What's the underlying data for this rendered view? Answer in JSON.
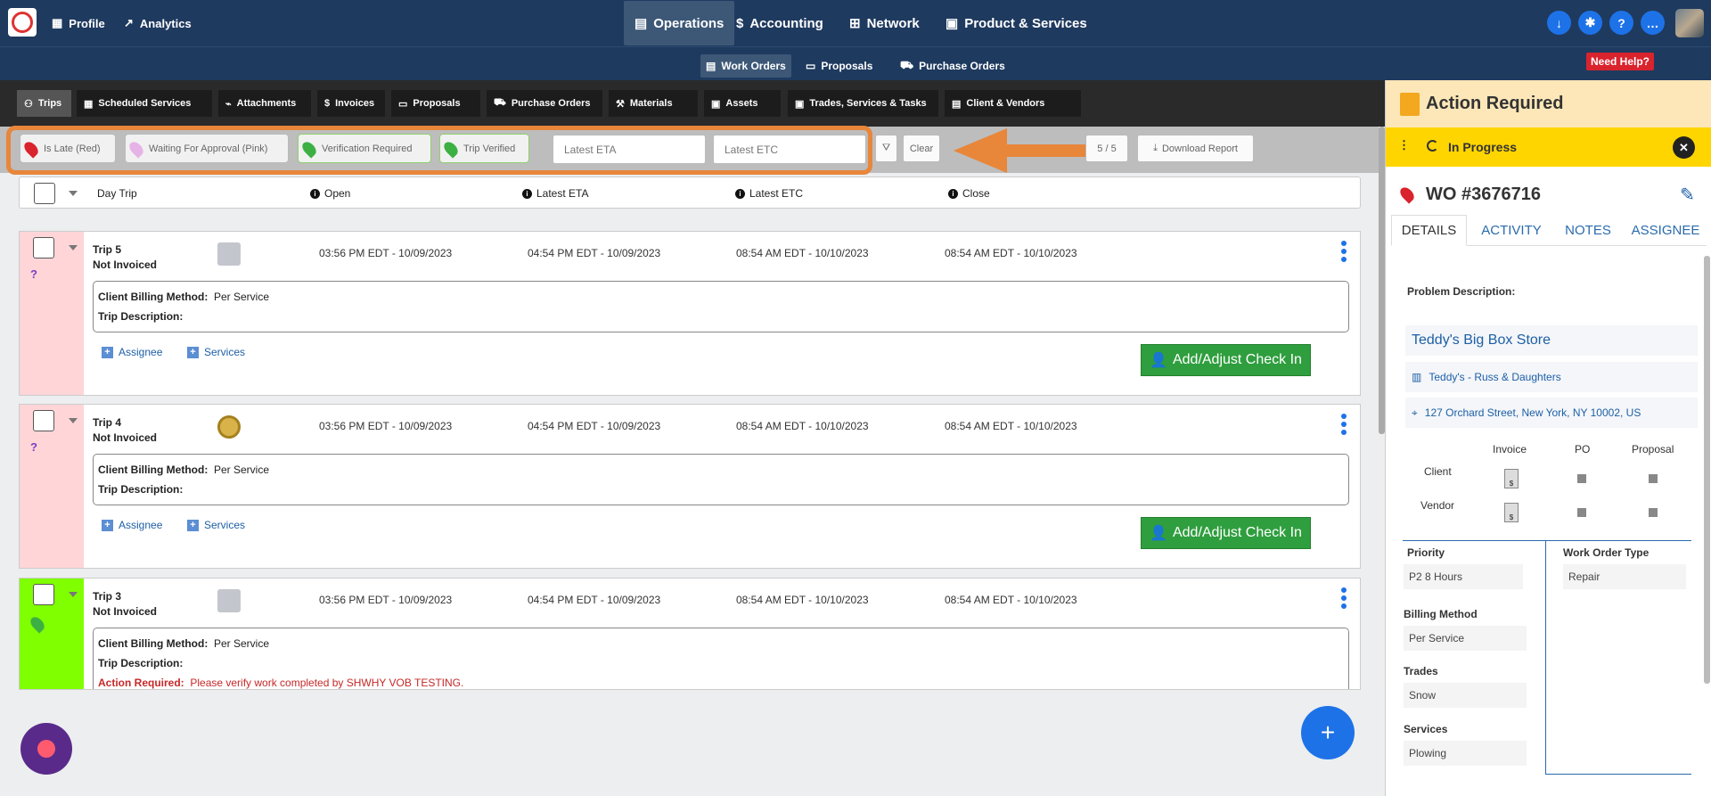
{
  "topnav": {
    "profile": "Profile",
    "analytics": "Analytics",
    "operations": "Operations",
    "accounting": "Accounting",
    "network": "Network",
    "product_services": "Product & Services"
  },
  "subnav": {
    "work_orders": "Work Orders",
    "proposals": "Proposals",
    "purchase_orders": "Purchase Orders",
    "need_help": "Need Help?"
  },
  "tabs": [
    "Trips",
    "Scheduled Services",
    "Attachments",
    "Invoices",
    "Proposals",
    "Purchase Orders",
    "Materials",
    "Assets",
    "Trades, Services & Tasks",
    "Client & Vendors"
  ],
  "filters": {
    "chips": [
      "Is Late (Red)",
      "Waiting For Approval (Pink)",
      "Verification Required",
      "Trip Verified"
    ],
    "eta_placeholder": "Latest ETA",
    "etc_placeholder": "Latest ETC",
    "clear": "Clear",
    "count": "5 / 5",
    "download": "Download Report"
  },
  "header": {
    "day_trip": "Day Trip",
    "open": "Open",
    "latest_eta": "Latest ETA",
    "latest_etc": "Latest ETC",
    "close": "Close"
  },
  "trips": [
    {
      "name": "Trip 5",
      "status": "Not Invoiced",
      "open": "03:56 PM EDT - 10/09/2023",
      "eta": "04:54 PM EDT - 10/09/2023",
      "etc": "08:54 AM EDT - 10/10/2023",
      "close": "08:54 AM EDT - 10/10/2023",
      "billing_label": "Client Billing Method:",
      "billing": "Per Service",
      "desc_label": "Trip Description:",
      "strip": "#ffd5d8",
      "marker": "?"
    },
    {
      "name": "Trip 4",
      "status": "Not Invoiced",
      "open": "03:56 PM EDT - 10/09/2023",
      "eta": "04:54 PM EDT - 10/09/2023",
      "etc": "08:54 AM EDT - 10/10/2023",
      "close": "08:54 AM EDT - 10/10/2023",
      "billing_label": "Client Billing Method:",
      "billing": "Per Service",
      "desc_label": "Trip Description:",
      "strip": "#ffd5d8",
      "marker": "?"
    },
    {
      "name": "Trip 3",
      "status": "Not Invoiced",
      "open": "03:56 PM EDT - 10/09/2023",
      "eta": "04:54 PM EDT - 10/09/2023",
      "etc": "08:54 AM EDT - 10/10/2023",
      "close": "08:54 AM EDT - 10/10/2023",
      "billing_label": "Client Billing Method:",
      "billing": "Per Service",
      "desc_label": "Trip Description:",
      "action_label": "Action Required:",
      "action": "Please verify work completed by SHWHY VOB TESTING.",
      "strip": "#7fff00"
    }
  ],
  "trip_links": {
    "assignee": "Assignee",
    "services": "Services",
    "checkin": "Add/Adjust Check In"
  },
  "panel": {
    "action_required": "Action Required",
    "status": "In Progress",
    "wo": "WO #3676716",
    "tabs": [
      "DETAILS",
      "ACTIVITY",
      "NOTES",
      "ASSIGNEE"
    ],
    "problem_label": "Problem Description:",
    "store": "Teddy's Big Box Store",
    "location": "Teddy's - Russ & Daughters",
    "address": "127 Orchard Street, New York, NY 10002, US",
    "grid_headers": [
      "Invoice",
      "PO",
      "Proposal"
    ],
    "grid_rows": [
      "Client",
      "Vendor"
    ],
    "priority_label": "Priority",
    "priority": "P2 8 Hours",
    "wo_type_label": "Work Order Type",
    "wo_type": "Repair",
    "billing_label": "Billing Method",
    "billing": "Per Service",
    "trades_label": "Trades",
    "trades": "Snow",
    "services_label": "Services",
    "services": "Plowing"
  },
  "colors": {
    "nav": "#1f3a5f",
    "accent_orange": "#e8863a",
    "green": "#2f9e3e",
    "blue": "#1d72e8",
    "yellow": "#ffd500"
  }
}
